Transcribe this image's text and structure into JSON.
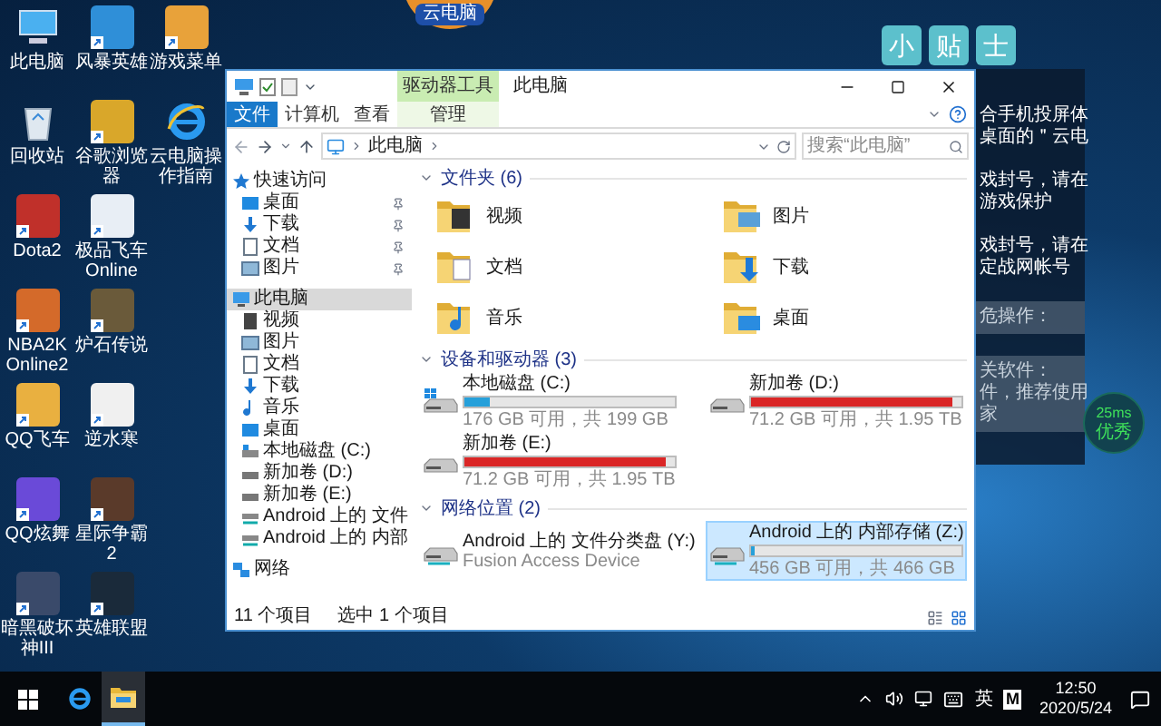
{
  "top_badge": {
    "label": "云电脑"
  },
  "desktop_icons": [
    [
      {
        "label": "此电脑",
        "kind": "pc"
      },
      {
        "label": "风暴英雄",
        "kind": "app",
        "color": "#2f8fd8"
      },
      {
        "label": "游戏菜单",
        "kind": "app",
        "color": "#e8a23a"
      }
    ],
    [
      {
        "label": "回收站",
        "kind": "recycle"
      },
      {
        "label": "谷歌浏览器",
        "kind": "app",
        "color": "#d9a72a"
      },
      {
        "label": "云电脑操作指南",
        "kind": "ie"
      }
    ],
    [
      {
        "label": "Dota2",
        "kind": "app",
        "color": "#c0302a"
      },
      {
        "label": "极品飞车Online",
        "kind": "app",
        "color": "#e8eef5"
      }
    ],
    [
      {
        "label": "NBA2K Online2",
        "kind": "app",
        "color": "#d46a2a"
      },
      {
        "label": "炉石传说",
        "kind": "app",
        "color": "#6a5a3a"
      }
    ],
    [
      {
        "label": "QQ飞车",
        "kind": "app",
        "color": "#e9b040"
      },
      {
        "label": "逆水寒",
        "kind": "app",
        "color": "#f0f0f0"
      }
    ],
    [
      {
        "label": "QQ炫舞",
        "kind": "app",
        "color": "#6a4ad8"
      },
      {
        "label": "星际争霸2",
        "kind": "app",
        "color": "#5a3a2a"
      }
    ],
    [
      {
        "label": "暗黑破坏神III",
        "kind": "app",
        "color": "#3a4a6a"
      },
      {
        "label": "英雄联盟",
        "kind": "app",
        "color": "#1a2a3a"
      }
    ]
  ],
  "tips_panel": {
    "title": [
      "小",
      "贴",
      "士"
    ],
    "paragraphs": [
      {
        "lines": [
          "合手机投屏体",
          "桌面的＂云电"
        ],
        "boxed": false
      },
      {
        "lines": [
          "戏封号，请在",
          "游戏保护"
        ],
        "boxed": false
      },
      {
        "lines": [
          "戏封号，请在",
          "定战网帐号"
        ],
        "boxed": false
      },
      {
        "lines": [
          "危操作："
        ],
        "boxed": true
      },
      {
        "lines": [
          "关软件：",
          "件，推荐使用",
          "家"
        ],
        "boxed": true
      }
    ]
  },
  "ping_badge": {
    "latency": "25ms",
    "rating": "优秀"
  },
  "window": {
    "context_tab": "驱动器工具",
    "title": "此电脑",
    "ribbon_tabs": [
      {
        "label": "文件",
        "kind": "file"
      },
      {
        "label": "计算机",
        "kind": "tab"
      },
      {
        "label": "查看",
        "kind": "tab"
      },
      {
        "label": "管理",
        "kind": "context"
      }
    ],
    "address": {
      "path": "此电脑"
    },
    "search": {
      "placeholder": "搜索“此电脑”"
    },
    "nav": [
      {
        "label": "快速访问",
        "kind": "star",
        "selected": false,
        "children": [
          {
            "label": "桌面",
            "kind": "desktop",
            "pinned": true,
            "selected": false
          },
          {
            "label": "下载",
            "kind": "download",
            "pinned": true,
            "selected": false
          },
          {
            "label": "文档",
            "kind": "document",
            "pinned": true,
            "selected": false
          },
          {
            "label": "图片",
            "kind": "picture",
            "pinned": true,
            "selected": false
          }
        ]
      },
      {
        "label": "此电脑",
        "kind": "pc",
        "selected": true,
        "children": [
          {
            "label": "视频",
            "kind": "video",
            "pinned": false,
            "selected": false
          },
          {
            "label": "图片",
            "kind": "picture",
            "pinned": false,
            "selected": false
          },
          {
            "label": "文档",
            "kind": "document",
            "pinned": false,
            "selected": false
          },
          {
            "label": "下载",
            "kind": "download",
            "pinned": false,
            "selected": false
          },
          {
            "label": "音乐",
            "kind": "music",
            "pinned": false,
            "selected": false
          },
          {
            "label": "桌面",
            "kind": "desktop",
            "pinned": false,
            "selected": false
          },
          {
            "label": "本地磁盘 (C:)",
            "kind": "drive-win",
            "pinned": false,
            "selected": false
          },
          {
            "label": "新加卷 (D:)",
            "kind": "drive",
            "pinned": false,
            "selected": false
          },
          {
            "label": "新加卷 (E:)",
            "kind": "drive",
            "pinned": false,
            "selected": false
          },
          {
            "label": "Android 上的 文件",
            "kind": "android",
            "pinned": false,
            "selected": false
          },
          {
            "label": "Android 上的 内部",
            "kind": "android",
            "pinned": false,
            "selected": false
          }
        ]
      },
      {
        "label": "网络",
        "kind": "network",
        "selected": false
      }
    ],
    "groups": [
      {
        "title": "文件夹 (6)",
        "kind": "folders",
        "items": [
          {
            "name": "视频",
            "kind": "video",
            "selected": false
          },
          {
            "name": "图片",
            "kind": "picture",
            "selected": false
          },
          {
            "name": "文档",
            "kind": "document",
            "selected": false
          },
          {
            "name": "下载",
            "kind": "download",
            "selected": false
          },
          {
            "name": "音乐",
            "kind": "music",
            "selected": false
          },
          {
            "name": "桌面",
            "kind": "desktop",
            "selected": false
          }
        ]
      },
      {
        "title": "设备和驱动器 (3)",
        "kind": "drives",
        "items": [
          {
            "name": "本地磁盘 (C:)",
            "kind": "windows",
            "level": 0.12,
            "detail": "176 GB 可用，共 199 GB",
            "selected": false
          },
          {
            "name": "新加卷 (D:)",
            "kind": "disk",
            "level": 0.96,
            "detail": "71.2 GB 可用，共 1.95 TB",
            "selected": false
          },
          {
            "name": "新加卷 (E:)",
            "kind": "disk",
            "level": 0.96,
            "detail": "71.2 GB 可用，共 1.95 TB",
            "selected": false
          }
        ]
      },
      {
        "title": "网络位置 (2)",
        "kind": "drives",
        "items": [
          {
            "name": "Android 上的 文件分类盘 (Y:)",
            "kind": "android",
            "detail": "Fusion Access Device",
            "selected": false
          },
          {
            "name": "Android 上的 内部存储 (Z:)",
            "kind": "android",
            "level": 0.02,
            "detail": "456 GB 可用，共 466 GB",
            "selected": true
          }
        ]
      }
    ],
    "status": {
      "count": "11 个项目",
      "selection": "选中 1 个项目"
    }
  },
  "taskbar": {
    "apps": [
      {
        "kind": "ie",
        "active": false
      },
      {
        "kind": "explorer",
        "active": true
      }
    ],
    "ime": "英",
    "ime_mode": "M",
    "time": "12:50",
    "date": "2020/5/24"
  }
}
